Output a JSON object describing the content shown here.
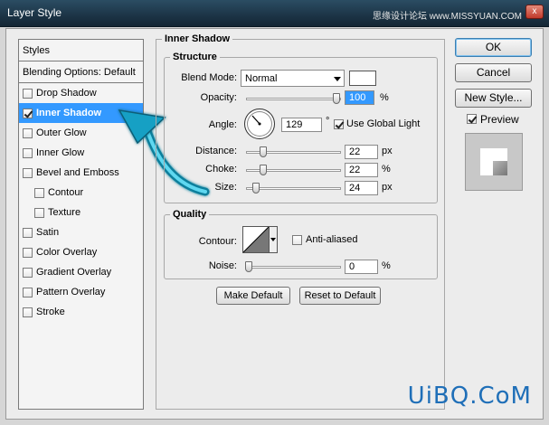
{
  "window": {
    "title": "Layer Style",
    "watermark": "思缘设计论坛 www.MISSYUAN.COM",
    "close_glyph": "x"
  },
  "styles_panel": {
    "header": "Styles",
    "blending": "Blending Options: Default",
    "items": [
      {
        "label": "Drop Shadow",
        "checked": false,
        "sub": false,
        "selected": false
      },
      {
        "label": "Inner Shadow",
        "checked": true,
        "sub": false,
        "selected": true
      },
      {
        "label": "Outer Glow",
        "checked": false,
        "sub": false,
        "selected": false
      },
      {
        "label": "Inner Glow",
        "checked": false,
        "sub": false,
        "selected": false
      },
      {
        "label": "Bevel and Emboss",
        "checked": false,
        "sub": false,
        "selected": false
      },
      {
        "label": "Contour",
        "checked": false,
        "sub": true,
        "selected": false
      },
      {
        "label": "Texture",
        "checked": false,
        "sub": true,
        "selected": false
      },
      {
        "label": "Satin",
        "checked": false,
        "sub": false,
        "selected": false
      },
      {
        "label": "Color Overlay",
        "checked": false,
        "sub": false,
        "selected": false
      },
      {
        "label": "Gradient Overlay",
        "checked": false,
        "sub": false,
        "selected": false
      },
      {
        "label": "Pattern Overlay",
        "checked": false,
        "sub": false,
        "selected": false
      },
      {
        "label": "Stroke",
        "checked": false,
        "sub": false,
        "selected": false
      }
    ]
  },
  "inner_shadow": {
    "title": "Inner Shadow",
    "structure": {
      "title": "Structure",
      "blend_mode_label": "Blend Mode:",
      "blend_mode_value": "Normal",
      "opacity_label": "Opacity:",
      "opacity_value": "100",
      "opacity_unit": "%",
      "opacity_level": 1.0,
      "angle_label": "Angle:",
      "angle_value": "129",
      "angle_unit": "°",
      "use_global_light_label": "Use Global Light",
      "use_global_light": true,
      "distance_label": "Distance:",
      "distance_value": "22",
      "distance_unit": "px",
      "choke_label": "Choke:",
      "choke_value": "22",
      "choke_unit": "%",
      "size_label": "Size:",
      "size_value": "24",
      "size_unit": "px"
    },
    "quality": {
      "title": "Quality",
      "contour_label": "Contour:",
      "anti_aliased_label": "Anti-aliased",
      "anti_aliased": false,
      "noise_label": "Noise:",
      "noise_value": "0",
      "noise_unit": "%"
    },
    "make_default": "Make Default",
    "reset_default": "Reset to Default"
  },
  "buttons": {
    "ok": "OK",
    "cancel": "Cancel",
    "new_style": "New Style...",
    "preview_label": "Preview",
    "preview_checked": true
  },
  "logo": "UiBQ.CoM",
  "colors": {
    "selection": "#3399ff",
    "arrow": "#1aa6c8",
    "logo": "#1f6fb8"
  }
}
